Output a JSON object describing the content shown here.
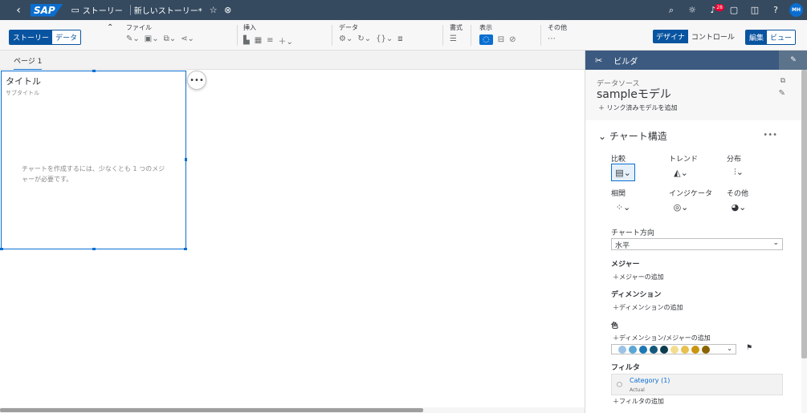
{
  "top": {
    "story_label": "ストーリー",
    "doc_title": "新しいストーリー*",
    "sap_logo": "SAP",
    "notif_count": "28",
    "avatar": "MH"
  },
  "toolbar": {
    "story_tab": "ストーリー",
    "data_tab": "データ",
    "file": "ファイル",
    "insert": "挿入",
    "data": "データ",
    "format": "書式",
    "display": "表示",
    "other": "その他",
    "designer": "デザイナ",
    "control": "コントロール",
    "edit": "編集",
    "view": "ビュー"
  },
  "page_tab": "ページ 1",
  "widget": {
    "title": "タイトル",
    "subtitle": "サブタイトル",
    "message": "チャートを作成するには、少なくとも 1 つのメジャーが必要です。"
  },
  "panel": {
    "title": "ビルダ",
    "datasource_label": "データソース",
    "model": "sampleモデル",
    "add_linked_model": "リンク済みモデルを追加",
    "chart_structure": "チャート構造",
    "types": {
      "compare": "比較",
      "trend": "トレンド",
      "distribution": "分布",
      "correlation": "相関",
      "indicator": "インジケータ",
      "other": "その他"
    },
    "orientation_label": "チャート方向",
    "orientation_value": "水平",
    "measure": "メジャー",
    "add_measure": "メジャーの追加",
    "dimension": "ディメンション",
    "add_dimension": "ディメンションの追加",
    "color": "色",
    "add_dim_measure": "ディメンション/メジャーの追加",
    "palette": [
      "#9cc3e6",
      "#5aa6d6",
      "#1d77b5",
      "#14597d",
      "#0d3b4f",
      "#f4dc8f",
      "#e8c04f",
      "#c99510",
      "#8a6400"
    ],
    "filter": "フィルタ",
    "filter_name": "Category (1)",
    "filter_value": "Actual",
    "add_filter": "フィルタの追加"
  }
}
